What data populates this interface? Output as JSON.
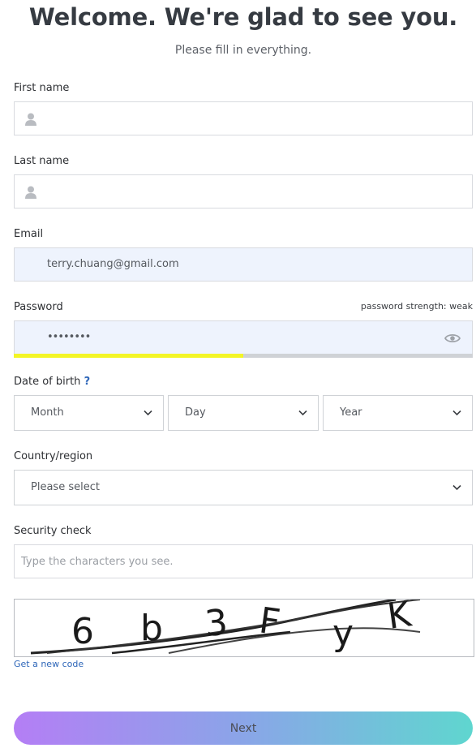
{
  "header": {
    "title": "Welcome. We're glad to see you.",
    "subtitle": "Please fill in everything."
  },
  "form": {
    "first_name": {
      "label": "First name",
      "value": "",
      "icon": "person-icon"
    },
    "last_name": {
      "label": "Last name",
      "value": "",
      "icon": "person-icon"
    },
    "email": {
      "label": "Email",
      "value": "terry.chuang@gmail.com"
    },
    "password": {
      "label": "Password",
      "value": "••••••••",
      "strength_text": "password strength: weak",
      "strength_fraction": 0.5,
      "strength_color": "#f3f526",
      "icon": "eye-icon"
    },
    "date_of_birth": {
      "label": "Date of birth",
      "help": "?",
      "month": "Month",
      "day": "Day",
      "year": "Year"
    },
    "country": {
      "label": "Country/region",
      "value": "Please select"
    },
    "security_check": {
      "label": "Security check",
      "placeholder": "Type the characters you see.",
      "captcha_text": "6b3FyK",
      "new_code_link": "Get a new code"
    }
  },
  "actions": {
    "next_label": "Next"
  },
  "colors": {
    "link": "#2f67b9",
    "filled_field_bg": "#eef3fd",
    "button_gradient": [
      "#b47ef5",
      "#8aa5e8",
      "#5fd6cf"
    ]
  }
}
